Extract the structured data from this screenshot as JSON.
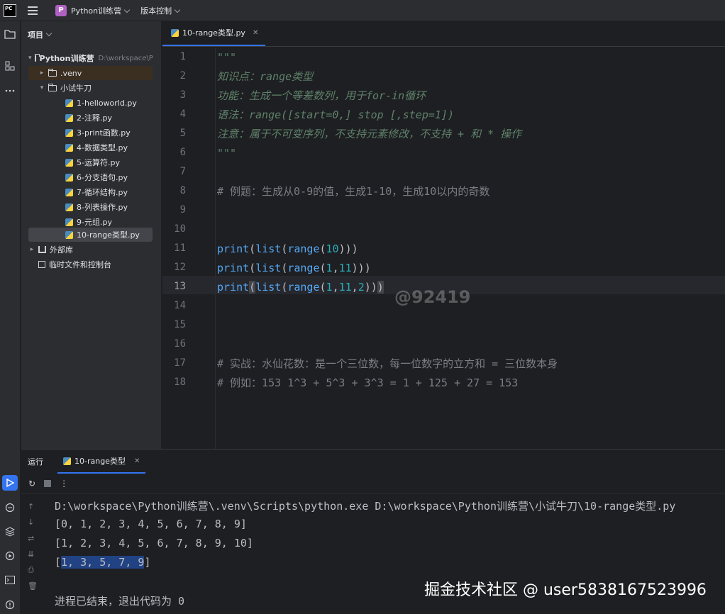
{
  "titlebar": {
    "logo": "PC",
    "project_badge": "P",
    "project_name": "Python训练营",
    "vcs": "版本控制"
  },
  "project_panel": {
    "title": "项目",
    "root_name": "Python训练营",
    "root_path": "D:\\workspace\\P",
    "venv": ".venv",
    "folder": "小试牛刀",
    "files": [
      "1-helloworld.py",
      "2-注释.py",
      "3-print函数.py",
      "4-数据类型.py",
      "5-运算符.py",
      "6-分支语句.py",
      "7-循环结构.py",
      "8-列表操作.py",
      "9-元组.py",
      "10-range类型.py"
    ],
    "selected_file": "10-range类型.py",
    "external_libs": "外部库",
    "scratches": "临时文件和控制台"
  },
  "editor": {
    "tab_label": "10-range类型.py",
    "current_line": 13,
    "lines": [
      {
        "n": "1",
        "text": "\"\"\""
      },
      {
        "n": "2",
        "text": "知识点：range类型"
      },
      {
        "n": "3",
        "text": "功能：生成一个等差数列，用于for-in循环"
      },
      {
        "n": "4",
        "text": "语法：range([start=0,] stop [,step=1])"
      },
      {
        "n": "5",
        "text": "注意：属于不可变序列，不支持元素修改，不支持 + 和 * 操作"
      },
      {
        "n": "6",
        "text": "\"\"\""
      },
      {
        "n": "7",
        "text": ""
      },
      {
        "n": "8",
        "text": "# 例题：生成从0-9的值，生成1-10，生成10以内的奇数"
      },
      {
        "n": "9",
        "text": ""
      },
      {
        "n": "10",
        "text": ""
      },
      {
        "n": "11",
        "text": "print(list(range(10)))"
      },
      {
        "n": "12",
        "text": "print(list(range(1,11)))"
      },
      {
        "n": "13",
        "text": "print(list(range(1,11,2)))"
      },
      {
        "n": "14",
        "text": ""
      },
      {
        "n": "15",
        "text": ""
      },
      {
        "n": "16",
        "text": ""
      },
      {
        "n": "17",
        "text": "# 实战：水仙花数：是一个三位数，每一位数字的立方和 = 三位数本身"
      },
      {
        "n": "18",
        "text": "# 例如：153 1^3 + 5^3 + 3^3 = 1 + 125 + 27 = 153"
      }
    ],
    "watermark": "@92419"
  },
  "run_panel": {
    "title": "运行",
    "tab_label": "10-range类型",
    "output": [
      "D:\\workspace\\Python训练营\\.venv\\Scripts\\python.exe D:\\workspace\\Python训练营\\小试牛刀\\10-range类型.py",
      "[0, 1, 2, 3, 4, 5, 6, 7, 8, 9]",
      "[1, 2, 3, 4, 5, 6, 7, 8, 9, 10]",
      "[1, 3, 5, 7, 9]",
      "",
      "进程已结束，退出代码为 0"
    ],
    "watermark": "掘金技术社区 @ user5838167523996"
  }
}
